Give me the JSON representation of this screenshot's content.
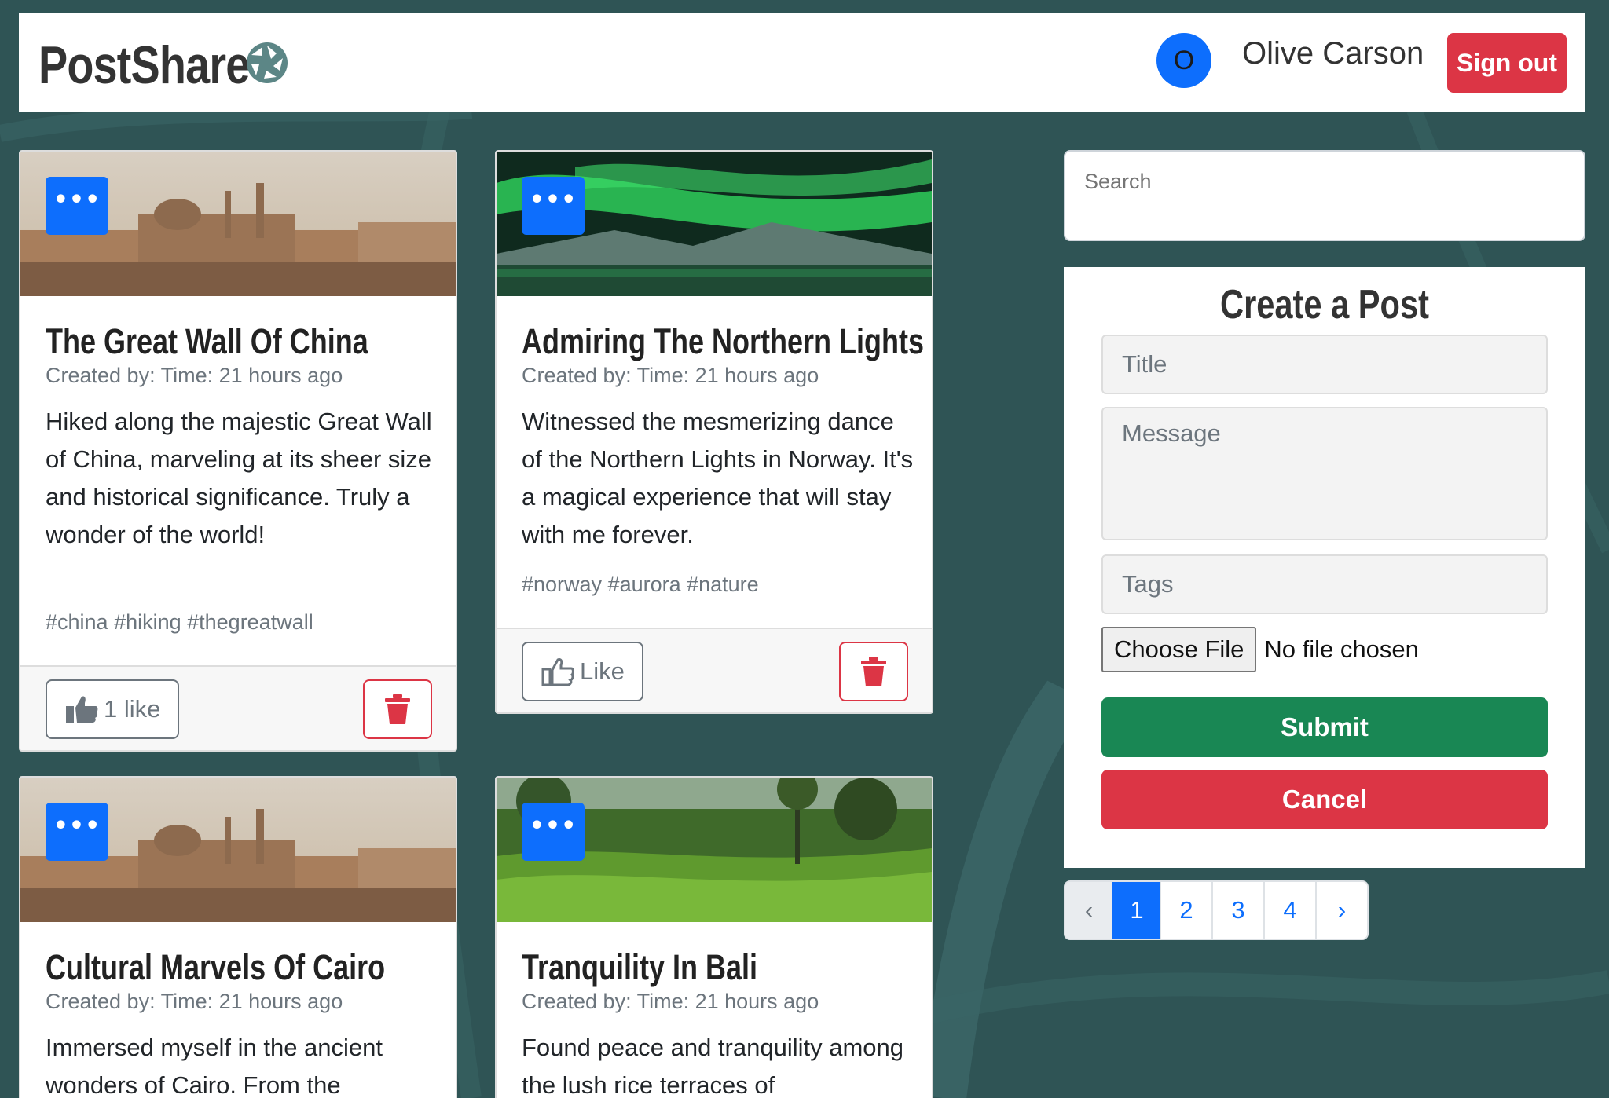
{
  "brand": {
    "title": "PostShare",
    "icon": "camera-aperture-icon"
  },
  "user": {
    "avatar_initial": "O",
    "name": "Olive Carson",
    "signout_label": "Sign out"
  },
  "posts": [
    {
      "title": "The Great Wall Of China",
      "meta": "Created by: Time: 21 hours ago",
      "message": "Hiked along the majestic Great Wall of China, marveling at its sheer size and historical significance. Truly a wonder of the world!",
      "tags": "#china #hiking #thegreatwall",
      "like_label": "1 like",
      "image": "cairo-cityscape"
    },
    {
      "title": "Admiring The Northern Lights",
      "meta": "Created by: Time: 21 hours ago",
      "message": "Witnessed the mesmerizing dance of the Northern Lights in Norway. It's a magical experience that will stay with me forever.",
      "tags": "#norway #aurora #nature",
      "like_label": "Like",
      "image": "northern-lights"
    },
    {
      "title": "Cultural Marvels Of Cairo",
      "meta": "Created by: Time: 21 hours ago",
      "message": "Immersed myself in the ancient wonders of Cairo. From the",
      "image": "cairo-cityscape"
    },
    {
      "title": "Tranquility In Bali",
      "meta": "Created by: Time: 21 hours ago",
      "message": "Found peace and tranquility among the lush rice terraces of",
      "image": "bali-rice-terraces"
    }
  ],
  "more_label": "•••",
  "search": {
    "placeholder": "Search"
  },
  "create_form": {
    "heading": "Create a Post",
    "title_placeholder": "Title",
    "message_placeholder": "Message",
    "tags_placeholder": "Tags",
    "file_button": "Choose File",
    "file_status": "No file chosen",
    "submit_label": "Submit",
    "cancel_label": "Cancel"
  },
  "pagination": {
    "prev": "‹",
    "pages": [
      "1",
      "2",
      "3",
      "4"
    ],
    "next": "›",
    "active": "1"
  },
  "colors": {
    "primary": "#0d6efd",
    "danger": "#dc3545",
    "success": "#198754",
    "background": "#2f5455"
  }
}
